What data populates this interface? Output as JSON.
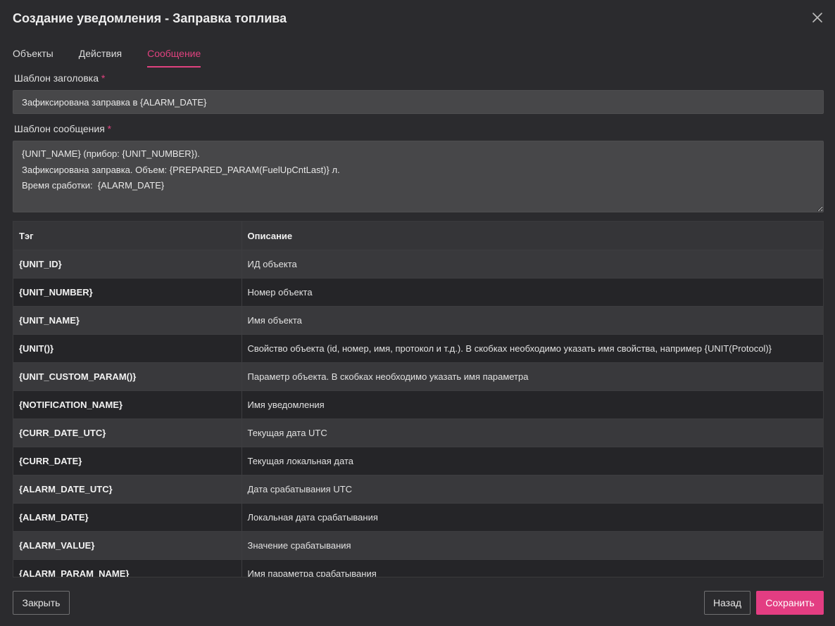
{
  "dialog": {
    "title": "Создание уведомления - Заправка топлива"
  },
  "tabs": [
    {
      "label": "Объекты"
    },
    {
      "label": "Действия"
    },
    {
      "label": "Сообщение"
    }
  ],
  "active_tab": "Сообщение",
  "form": {
    "header_label": "Шаблон заголовка",
    "header_value": "Зафиксирована заправка в {ALARM_DATE}",
    "message_label": "Шаблон сообщения",
    "message_value": "{UNIT_NAME} (прибор: {UNIT_NUMBER}).\nЗафиксирована заправка. Объем: {PREPARED_PARAM(FuelUpCntLast)} л.\nВремя сработки:  {ALARM_DATE}",
    "required_mark": "*"
  },
  "table": {
    "columns": [
      "Тэг",
      "Описание"
    ],
    "rows": [
      {
        "tag": "{UNIT_ID}",
        "desc": "ИД объекта"
      },
      {
        "tag": "{UNIT_NUMBER}",
        "desc": "Номер объекта"
      },
      {
        "tag": "{UNIT_NAME}",
        "desc": "Имя объекта"
      },
      {
        "tag": "{UNIT()}",
        "desc": "Свойство объекта (id, номер, имя, протокол и т.д.). В скобках необходимо указать имя свойства, например {UNIT(Protocol)}"
      },
      {
        "tag": "{UNIT_CUSTOM_PARAM()}",
        "desc": "Параметр объекта. В скобках необходимо указать имя параметра"
      },
      {
        "tag": "{NOTIFICATION_NAME}",
        "desc": "Имя уведомления"
      },
      {
        "tag": "{CURR_DATE_UTC}",
        "desc": "Текущая дата UTC"
      },
      {
        "tag": "{CURR_DATE}",
        "desc": "Текущая локальная дата"
      },
      {
        "tag": "{ALARM_DATE_UTC}",
        "desc": "Дата срабатывания UTC"
      },
      {
        "tag": "{ALARM_DATE}",
        "desc": "Локальная дата срабатывания"
      },
      {
        "tag": "{ALARM_VALUE}",
        "desc": "Значение срабатывания"
      },
      {
        "tag": "{ALARM_PARAM_NAME}",
        "desc": "Имя параметра срабатывания"
      }
    ]
  },
  "buttons": {
    "close": "Закрыть",
    "back": "Назад",
    "save": "Сохранить"
  },
  "colors": {
    "accent": "#e33d82",
    "background": "#2b2b2e"
  },
  "icons": {
    "close": "close-icon"
  }
}
